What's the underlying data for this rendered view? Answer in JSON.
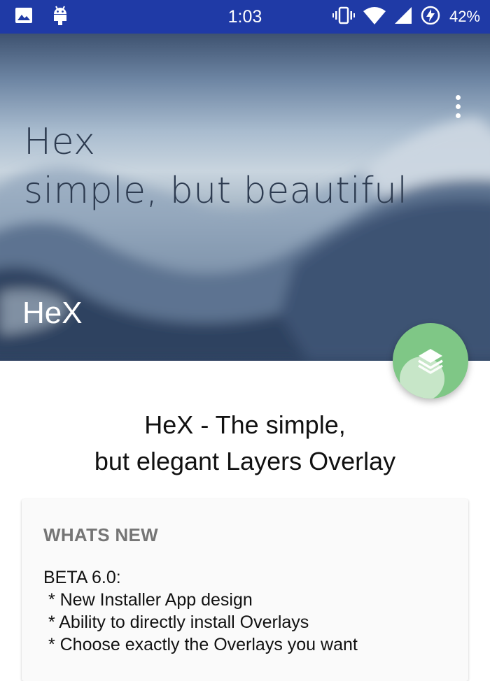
{
  "status_bar": {
    "time": "1:03",
    "battery": "42%",
    "icons": [
      "image-icon",
      "android-icon",
      "vibrate-icon",
      "wifi-icon",
      "signal-icon",
      "battery-saver-icon"
    ],
    "background": "#1f3aa6"
  },
  "header": {
    "tagline_line1": "Hex",
    "tagline_line2": "simple, but beautiful",
    "title": "HeX",
    "overflow_icon": "more-vert-icon"
  },
  "fab": {
    "icon": "layers-icon",
    "color": "#7fc786"
  },
  "main": {
    "headline_line1": "HeX - The simple,",
    "headline_line2": "but elegant Layers Overlay",
    "card": {
      "title": "WHATS NEW",
      "lines": [
        "BETA 6.0:",
        " * New Installer App design",
        " * Ability to directly install Overlays",
        " * Choose exactly the Overlays you want"
      ]
    }
  }
}
